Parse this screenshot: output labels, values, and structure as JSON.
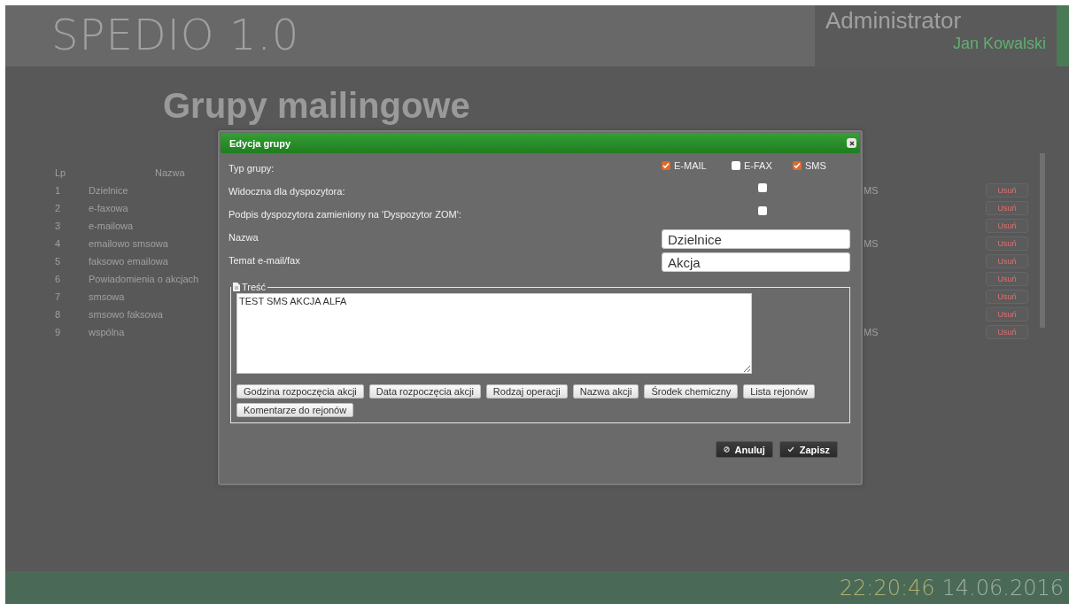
{
  "header": {
    "title": "SPEDIO 1.0",
    "user_role": "Administrator",
    "user_name": "Jan Kowalski"
  },
  "page": {
    "title": "Grupy mailingowe",
    "columns": [
      "Lp",
      "Nazwa"
    ],
    "rows": [
      {
        "lp": "1",
        "name": "Dzielnice",
        "type_text": "MS",
        "action": "Usuń"
      },
      {
        "lp": "2",
        "name": "e-faxowa",
        "action": "Usuń"
      },
      {
        "lp": "3",
        "name": "e-mailowa",
        "action": "Usuń"
      },
      {
        "lp": "4",
        "name": "emailowo smsowa",
        "type_text": "MS",
        "action": "Usuń"
      },
      {
        "lp": "5",
        "name": "faksowo emailowa",
        "action": "Usuń"
      },
      {
        "lp": "6",
        "name": "Powiadomienia o akcjach",
        "action": "Usuń"
      },
      {
        "lp": "7",
        "name": "smsowa",
        "action": "Usuń"
      },
      {
        "lp": "8",
        "name": "smsowo faksowa",
        "action": "Usuń"
      },
      {
        "lp": "9",
        "name": "wspólna",
        "type_text": "MS",
        "action": "Usuń"
      }
    ]
  },
  "dialog": {
    "title": "Edycja grupy",
    "fields": [
      {
        "kind": "checkgroup",
        "label": "Typ grupy:",
        "options": [
          {
            "label": "E-MAIL",
            "checked": true
          },
          {
            "label": "E-FAX",
            "checked": false
          },
          {
            "label": "SMS",
            "checked": true
          }
        ]
      },
      {
        "kind": "checkbox",
        "label": "Widoczna dla dyspozytora:",
        "checked": false
      },
      {
        "kind": "checkbox",
        "label": "Podpis dyspozytora zamieniony na 'Dyspozytor ZOM':",
        "checked": false
      },
      {
        "kind": "text",
        "label": "Nazwa",
        "value": "Dzielnice"
      },
      {
        "kind": "text",
        "label": "Temat e-mail/fax",
        "value": "Akcja"
      }
    ],
    "content": {
      "legend": "Treść",
      "value": "TEST SMS AKCJA ALFA",
      "insert_buttons": [
        "Godzina rozpoczęcia akcji",
        "Data rozpoczęcia akcji",
        "Rodzaj operacji",
        "Nazwa akcji",
        "Środek chemiczny",
        "Lista rejonów",
        "Komentarze do rejonów"
      ]
    },
    "buttons": [
      {
        "kind": "cancel",
        "label": "Anuluj"
      },
      {
        "kind": "save",
        "label": "Zapisz"
      }
    ]
  },
  "status_bar": {
    "time": "22:20:46",
    "date": "14.06.2016"
  }
}
